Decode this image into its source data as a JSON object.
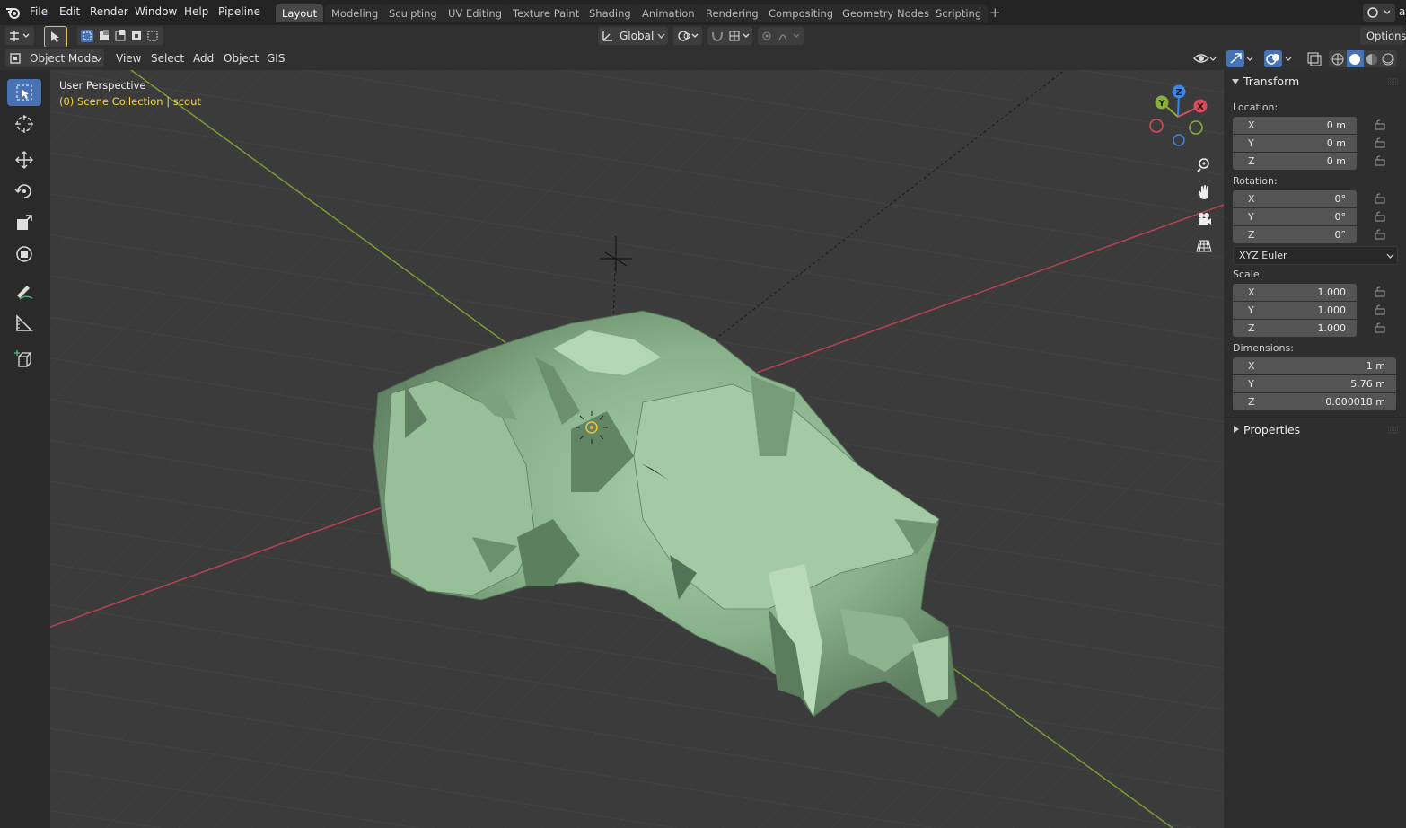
{
  "menu": {
    "items": [
      "File",
      "Edit",
      "Render",
      "Window",
      "Help",
      "Pipeline"
    ],
    "user_partial": "ar"
  },
  "workspaces": {
    "tabs": [
      "Layout",
      "Modeling",
      "Sculpting",
      "UV Editing",
      "Texture Paint",
      "Shading",
      "Animation",
      "Rendering",
      "Compositing",
      "Geometry Nodes",
      "Scripting"
    ],
    "active": "Layout",
    "add_label": "+"
  },
  "tool_header": {
    "orientation": "Global",
    "options_label": "Options"
  },
  "view_header": {
    "mode": "Object Mode",
    "menus": [
      "View",
      "Select",
      "Add",
      "Object",
      "GIS"
    ]
  },
  "viewport": {
    "perspective": "User Perspective",
    "collection": "(0) Scene Collection | scout",
    "gizmo": {
      "x": "X",
      "y": "Y",
      "z": "Z"
    }
  },
  "npanel": {
    "transform_title": "Transform",
    "location_label": "Location:",
    "location": [
      {
        "axis": "X",
        "value": "0 m"
      },
      {
        "axis": "Y",
        "value": "0 m"
      },
      {
        "axis": "Z",
        "value": "0 m"
      }
    ],
    "rotation_label": "Rotation:",
    "rotation": [
      {
        "axis": "X",
        "value": "0°"
      },
      {
        "axis": "Y",
        "value": "0°"
      },
      {
        "axis": "Z",
        "value": "0°"
      }
    ],
    "rotation_mode": "XYZ Euler",
    "scale_label": "Scale:",
    "scale": [
      {
        "axis": "X",
        "value": "1.000"
      },
      {
        "axis": "Y",
        "value": "1.000"
      },
      {
        "axis": "Z",
        "value": "1.000"
      }
    ],
    "dimensions_label": "Dimensions:",
    "dimensions": [
      {
        "axis": "X",
        "value": "1 m"
      },
      {
        "axis": "Y",
        "value": "5.76 m"
      },
      {
        "axis": "Z",
        "value": "0.000018 m"
      }
    ],
    "properties_title": "Properties"
  },
  "colors": {
    "accent": "#4772b3",
    "mesh": "#8fb592",
    "x_axis": "#d34d5c",
    "y_axis": "#8bb03a",
    "z_axis": "#3f86e0",
    "header_text_yellow": "#f5d547"
  }
}
